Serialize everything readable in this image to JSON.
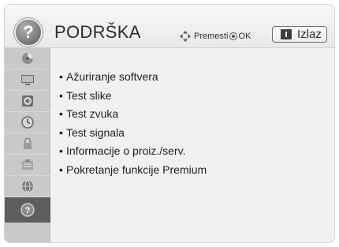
{
  "header": {
    "title": "PODRŠKA",
    "nav_hint": "Premesti",
    "ok_label": "OK",
    "exit_label": "Izlaz"
  },
  "sidebar": {
    "items": [
      {
        "icon": "picture-wizard-icon",
        "active": false
      },
      {
        "icon": "monitor-icon",
        "active": false
      },
      {
        "icon": "speaker-icon",
        "active": false
      },
      {
        "icon": "clock-icon",
        "active": false
      },
      {
        "icon": "lock-icon",
        "active": false
      },
      {
        "icon": "options-icon",
        "active": false
      },
      {
        "icon": "network-globe-icon",
        "active": false
      },
      {
        "icon": "help-icon",
        "active": true
      }
    ]
  },
  "menu": {
    "bullet": "•",
    "items": [
      "Ažuriranje softvera",
      "Test slike",
      "Test zvuka",
      "Test signala",
      "Informacije o proiz./serv.",
      "Pokretanje funkcije Premium"
    ]
  },
  "colors": {
    "background": "#f1f1f1",
    "sidebar": "#c9c9c9",
    "sidebar_active": "#5e5e5e",
    "text": "#1e1e1e"
  }
}
